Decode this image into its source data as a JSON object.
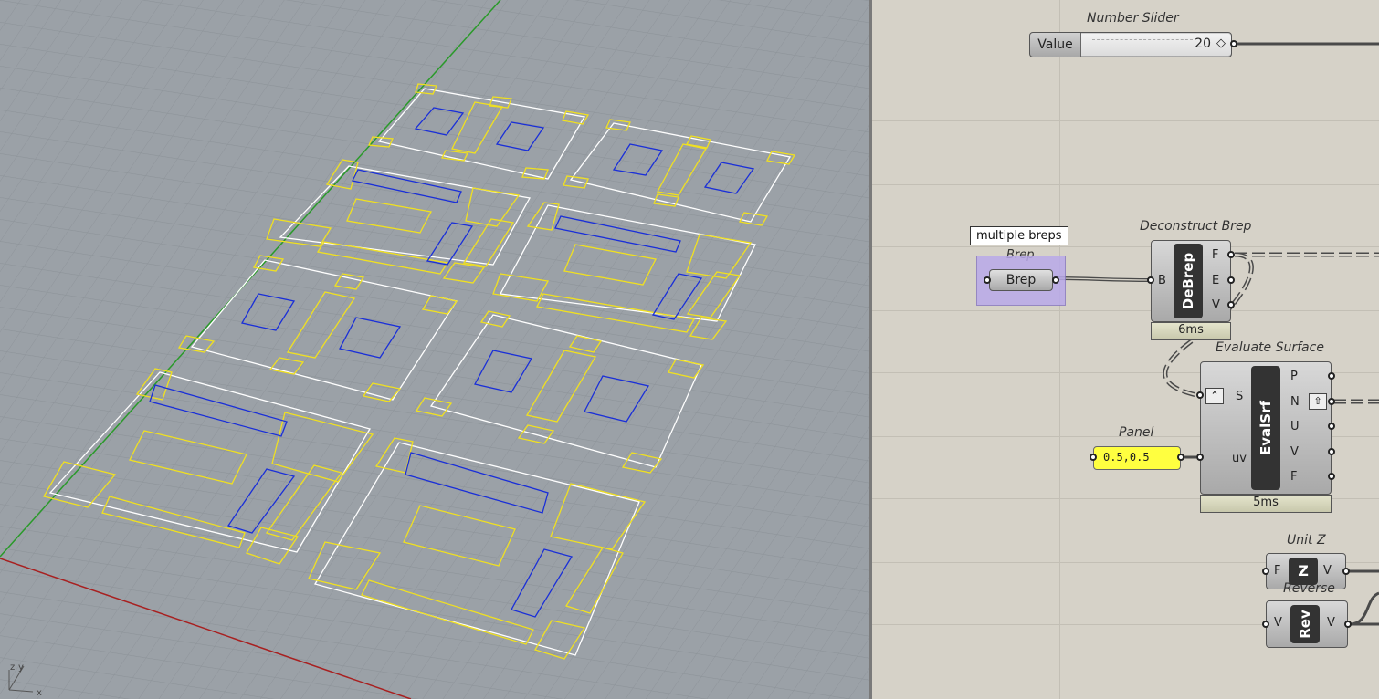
{
  "viewport": {
    "axis_labels": {
      "z": "z",
      "y": "y",
      "x": "x"
    },
    "colors": {
      "boundary": "#ffffff",
      "offset_curve": "#f0e020",
      "inner_curve": "#1a2fd8",
      "x_axis": "#b02020",
      "y_axis": "#20a020",
      "grid": "#8a9096"
    }
  },
  "canvas": {
    "number_slider": {
      "title": "Number Slider",
      "label": "Value",
      "value": "20"
    },
    "brep": {
      "tooltip": "multiple breps",
      "title": "Brep",
      "label": "Brep"
    },
    "deconstruct_brep": {
      "title": "Deconstruct Brep",
      "input": "B",
      "name": "DeBrep",
      "outputs": [
        "F",
        "E",
        "V"
      ],
      "time": "6ms"
    },
    "evaluate_surface": {
      "title": "Evaluate Surface",
      "inputs": [
        "S",
        "uv"
      ],
      "name": "EvalSrf",
      "outputs": [
        "P",
        "N",
        "U",
        "V",
        "F"
      ],
      "time": "5ms"
    },
    "panel": {
      "title": "Panel",
      "value": "0.5,0.5"
    },
    "unit_z": {
      "title": "Unit Z",
      "input": "F",
      "name": "Z",
      "output": "V"
    },
    "reverse": {
      "title": "Reverse",
      "input": "V",
      "name": "Rev",
      "output": "V"
    },
    "colors": {
      "brep_selected": "#b8a8e8",
      "panel_fill": "#ffff40",
      "wire": "#555555"
    }
  }
}
